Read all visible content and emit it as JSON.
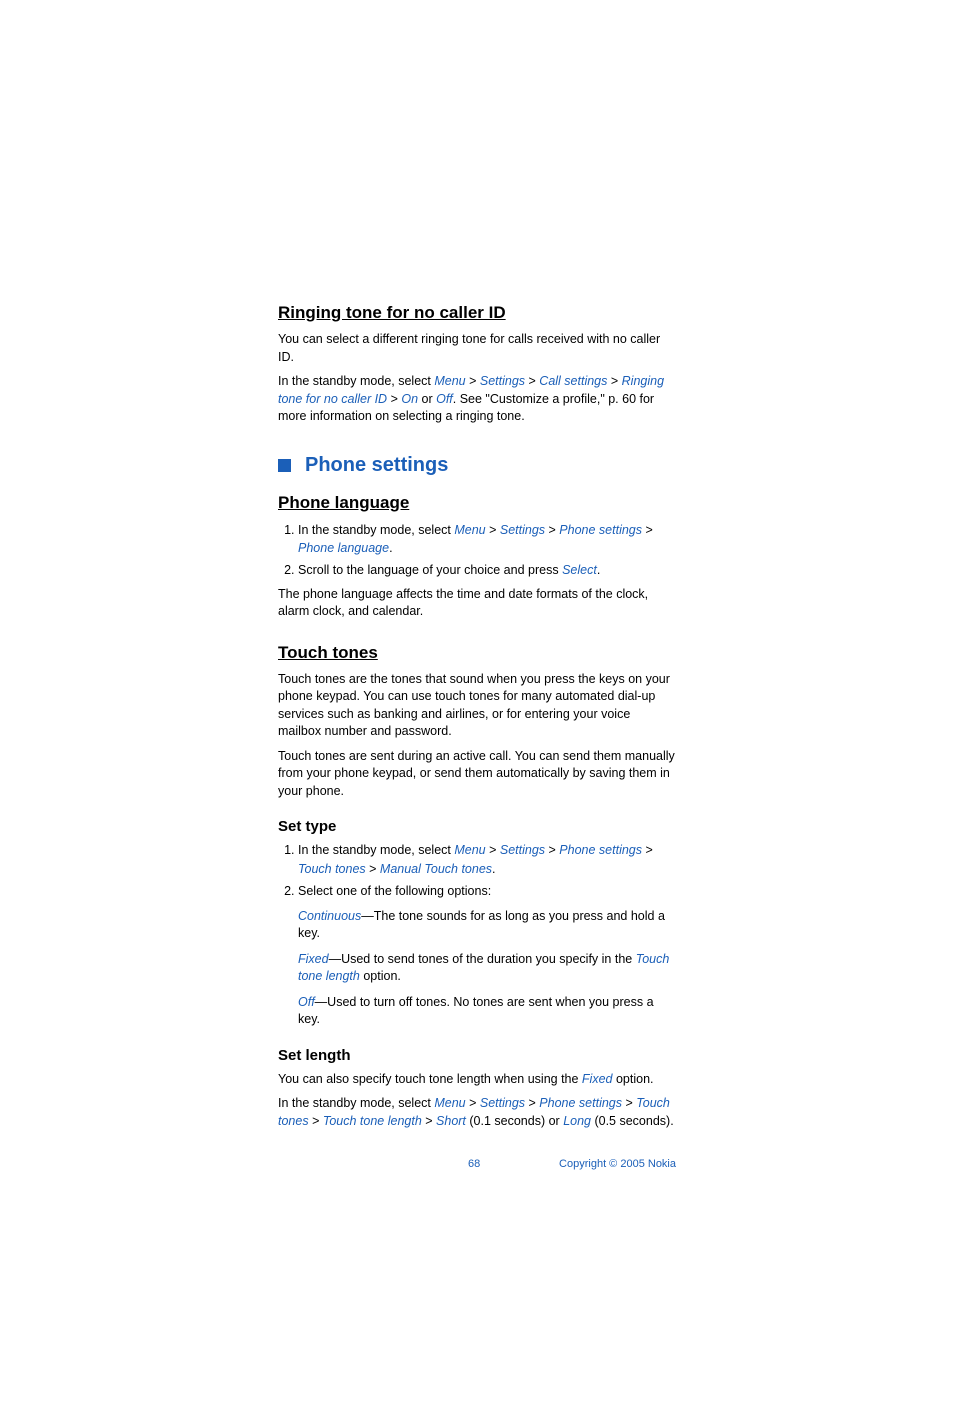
{
  "s1": {
    "title": "Ringing tone for no caller ID",
    "p1": "You can select a different ringing tone for calls received with no caller ID.",
    "p2a": "In the standby mode, select ",
    "menu": "Menu",
    "settings": "Settings",
    "callsettings": "Call settings",
    "ringtone": "Ringing tone for no caller ID",
    "on": "On",
    "off": "Off",
    "p2b": ". See \"Customize a profile,\" p. 60 for more information on selecting a ringing tone."
  },
  "s2": {
    "title": "Phone settings"
  },
  "s3": {
    "title": "Phone language",
    "li1a": "In the standby mode, select ",
    "menu": "Menu",
    "settings": "Settings",
    "phonesettings": "Phone settings",
    "phonelang": "Phone language",
    "li2a": "Scroll to the language of your choice and press ",
    "select": "Select",
    "p1": "The phone language affects the time and date formats of the clock, alarm clock, and calendar."
  },
  "s4": {
    "title": "Touch tones",
    "p1": "Touch tones are the tones that sound when you press the keys on your phone keypad. You can use touch tones for many automated dial-up services such as banking and airlines, or for entering your voice mailbox number and password.",
    "p2": "Touch tones are sent during an active call. You can send them manually from your phone keypad, or send them automatically by saving them in your phone."
  },
  "s5": {
    "title": "Set type",
    "li1a": "In the standby mode, select ",
    "menu": "Menu",
    "settings": "Settings",
    "phonesettings": "Phone settings",
    "touchtones": "Touch tones",
    "manual": "Manual Touch tones",
    "li2": "Select one of the following options:",
    "o1k": "Continuous",
    "o1t": "—The tone sounds for as long as you press and hold a key.",
    "o2k": "Fixed",
    "o2ta": "—Used to send tones of the duration you specify in the ",
    "o2link": "Touch tone length",
    "o2tb": " option.",
    "o3k": "Off",
    "o3t": "—Used to turn off tones. No tones are sent when you press a key."
  },
  "s6": {
    "title": "Set length",
    "p1a": "You can also specify touch tone length when using the ",
    "fixed": "Fixed",
    "p1b": " option.",
    "p2a": "In the standby mode, select ",
    "menu": "Menu",
    "settings": "Settings",
    "phonesettings": "Phone settings",
    "touchtones": "Touch tones",
    "ttlen": "Touch tone length",
    "short": "Short",
    "shortdur": " (0.1 seconds) or ",
    "long": "Long",
    "longdur": " (0.5 seconds)."
  },
  "footer": {
    "page": "68",
    "copy": "Copyright © 2005 Nokia"
  },
  "sep": " > ",
  "or": " or "
}
